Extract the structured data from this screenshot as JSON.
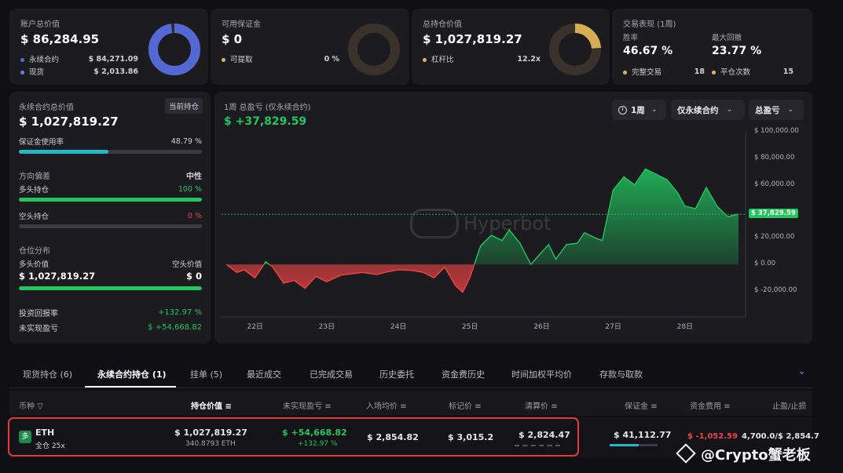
{
  "summary": {
    "account": {
      "label": "账户总价值",
      "value": "$ 86,284.95",
      "rows": [
        {
          "label": "永续合约",
          "value": "$ 84,271.09",
          "color": "#4f6fde"
        },
        {
          "label": "现货",
          "value": "$ 2,013.86",
          "color": "#6d7ff0"
        }
      ],
      "donut_ratio": 0.977,
      "donut_color": "#5468d4"
    },
    "margin": {
      "label": "可用保证金",
      "value": "$ 0",
      "rows": [
        {
          "label": "可提取",
          "value": "0 %",
          "color": "#e0b356"
        }
      ],
      "donut_ratio": 0.0,
      "donut_color": "#3a322a"
    },
    "position": {
      "label": "总持仓价值",
      "value": "$ 1,027,819.27",
      "rows": [
        {
          "label": "杠杆比",
          "value": "12.2x",
          "color": "#e0b356"
        }
      ],
      "donut_ratio": 0.24,
      "donut_color": "#d6ad54"
    },
    "perf": {
      "label": "交易表现 (1周)",
      "winrate_label": "胜率",
      "winrate": "46.67 %",
      "drawdown_label": "最大回撤",
      "drawdown": "23.77 %",
      "rows": [
        {
          "label": "完整交易",
          "value": "18",
          "color": "#e0b356"
        },
        {
          "label": "平仓次数",
          "value": "15",
          "color": "#e0b356"
        }
      ]
    }
  },
  "left_panel": {
    "title": "永续合约总价值",
    "badge": "当前持仓",
    "value": "$ 1,027,819.27",
    "margin_usage_label": "保证金使用率",
    "margin_usage": "48.79 %",
    "margin_usage_ratio": 0.4879,
    "bias_label": "方向偏差",
    "bias_value": "中性",
    "long_label": "多头持仓",
    "long_pct": "100 %",
    "long_ratio": 1.0,
    "short_label": "空头持仓",
    "short_pct": "0 %",
    "short_ratio": 0.0,
    "dist_label": "仓位分布",
    "long_value_label": "多头价值",
    "long_value": "$ 1,027,819.27",
    "short_value_label": "空头价值",
    "short_value": "$ 0",
    "roi_label": "投资回报率",
    "roi": "+132.97 %",
    "unrealized_label": "未实现盈亏",
    "unrealized": "$ +54,668.82"
  },
  "chart_panel": {
    "title": "1周 总盈亏 (仅永续合约)",
    "total": "$ +37,829.59",
    "controls": {
      "period": "1周",
      "scope": "仅永续合约",
      "metric": "总盈亏"
    },
    "watermark": "Hyperbot"
  },
  "chart_data": {
    "type": "area",
    "x_ticks": [
      "22日",
      "23日",
      "24日",
      "25日",
      "26日",
      "27日",
      "28日"
    ],
    "y_ticks": [
      "$ 100,000.00",
      "$ 80,000.00",
      "$ 60,000.00",
      "$ 40,000.00",
      "$ 20,000.00",
      "$ 0.00",
      "$ -20,000.00"
    ],
    "ylim": [
      -20000,
      100000
    ],
    "current_label": "$ 37,829.59",
    "current_value": 37829.59,
    "series": [
      {
        "x": [
          21.6,
          21.75,
          21.85,
          22.0,
          22.15,
          22.25,
          22.4,
          22.55,
          22.7,
          22.85,
          23.0,
          23.2,
          23.35,
          23.5,
          23.7,
          23.85,
          24.0,
          24.2,
          24.35,
          24.5,
          24.65,
          24.8,
          24.9,
          25.0,
          25.15,
          25.3,
          25.45,
          25.55,
          25.7,
          25.85,
          26.0,
          26.1,
          26.2,
          26.35,
          26.5,
          26.6,
          26.75,
          26.85,
          27.0,
          27.15,
          27.3,
          27.45,
          27.6,
          27.75,
          27.9,
          28.0,
          28.15,
          28.3,
          28.45,
          28.6,
          28.75
        ],
        "y": [
          0,
          -6000,
          -4000,
          -10000,
          2000,
          -2000,
          -14000,
          -12000,
          -18000,
          -9000,
          -13000,
          -8000,
          -7000,
          -6000,
          -7500,
          -5500,
          -4000,
          -4500,
          -6000,
          -10000,
          -2000,
          -16000,
          -21000,
          -10000,
          14000,
          22000,
          18000,
          26000,
          16000,
          0,
          9000,
          15000,
          4000,
          15000,
          16000,
          24000,
          20000,
          18000,
          56000,
          66000,
          60000,
          72000,
          68000,
          64000,
          54000,
          44000,
          42000,
          58000,
          44000,
          36000,
          38000
        ]
      }
    ]
  },
  "tabs": [
    "现货持仓 (6)",
    "永续合约持仓 (1)",
    "挂单 (5)",
    "最近成交",
    "已完成交易",
    "历史委托",
    "资金费历史",
    "时间加权平均价",
    "存款与取款"
  ],
  "table": {
    "headers": [
      "币种",
      "持仓价值",
      "未实现盈亏",
      "入场均价",
      "标记价",
      "清算价",
      "保证金",
      "资金费用",
      "止盈/止损"
    ],
    "row": {
      "icon": "多",
      "coin": "ETH",
      "sub": "全仓 25x",
      "value": "$ 1,027,819.27",
      "size": "340.8793 ETH",
      "pnl": "$ +54,668.82",
      "pnl_pct": "+132.97 %",
      "entry": "$ 2,854.82",
      "mark": "$ 3,015.2",
      "liq": "$ 2,824.47",
      "margin": "$ 41,112.77",
      "funding": "$ -1,052.59",
      "tpsl": "4,700.0/$ 2,854.7"
    }
  },
  "footer_watermark": "@Crypto蟹老板"
}
